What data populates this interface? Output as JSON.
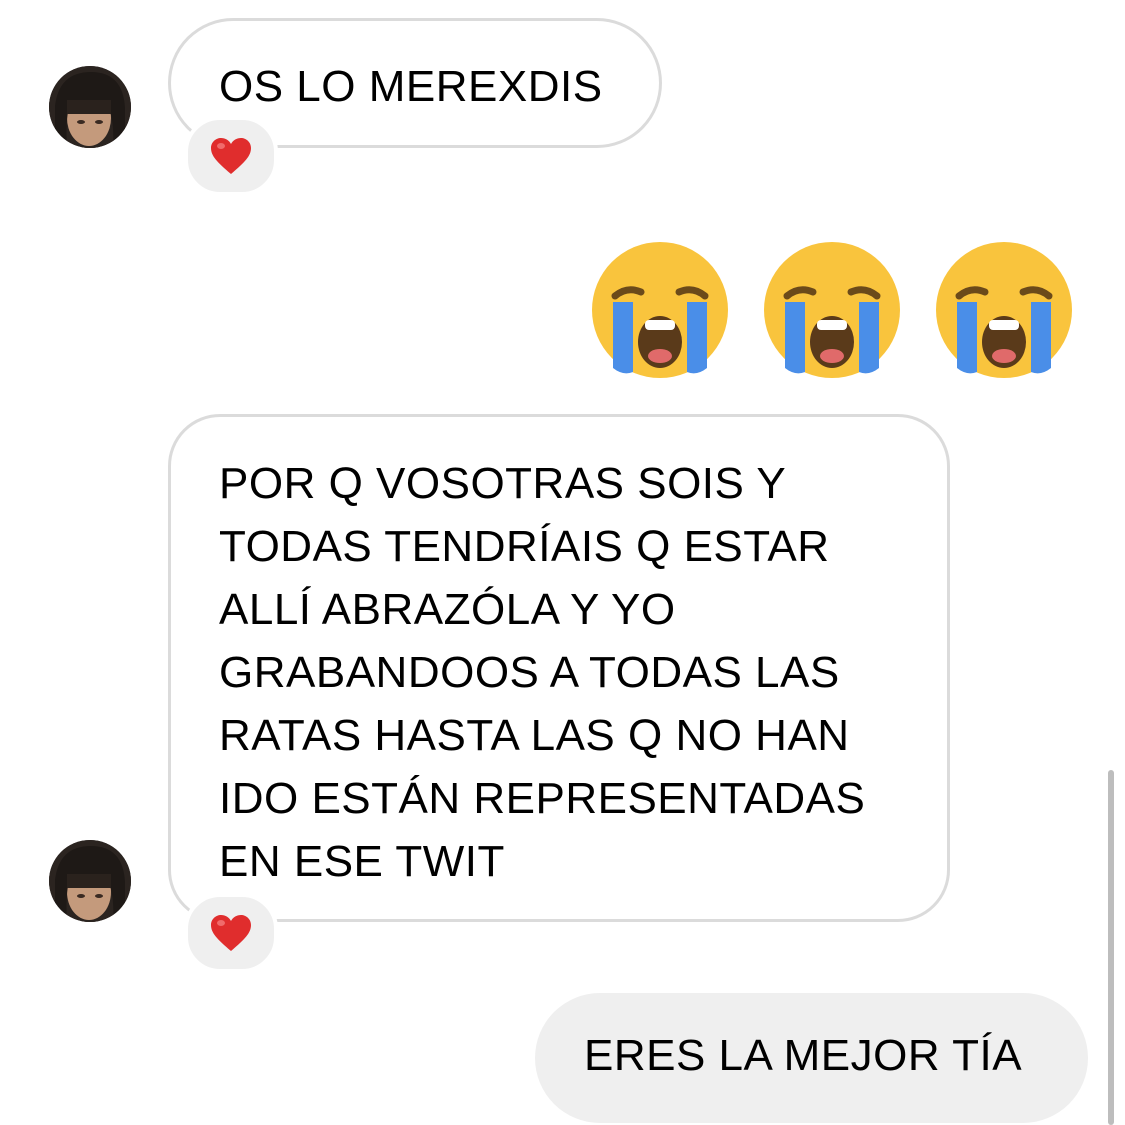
{
  "thread": {
    "messages": [
      {
        "sender": "other",
        "text": "OS LO MEREXDIS",
        "reaction": "red-heart"
      },
      {
        "sender": "me",
        "emoji": [
          "loudly-crying-face",
          "loudly-crying-face",
          "loudly-crying-face"
        ]
      },
      {
        "sender": "other",
        "lines": [
          "POR Q VOSOTRAS SOIS Y",
          "TODAS TENDRÍAIS Q ESTAR",
          "ALLÍ ABRAZÓLA Y YO",
          "GRABANDOOS A TODAS LAS",
          "RATAS HASTA LAS Q NO HAN",
          "IDO ESTÁN REPRESENTADAS",
          "EN ESE TWIT"
        ],
        "reaction": "red-heart"
      },
      {
        "sender": "me",
        "text": "ERES LA MEJOR TÍA"
      }
    ]
  },
  "colors": {
    "incoming_border": "#dbdbdb",
    "outgoing_bg": "#efefef",
    "reaction_bg": "#efefef",
    "heart": "#e02d2d",
    "emoji_face": "#f9c43d",
    "emoji_tears": "#4a8ee8"
  }
}
